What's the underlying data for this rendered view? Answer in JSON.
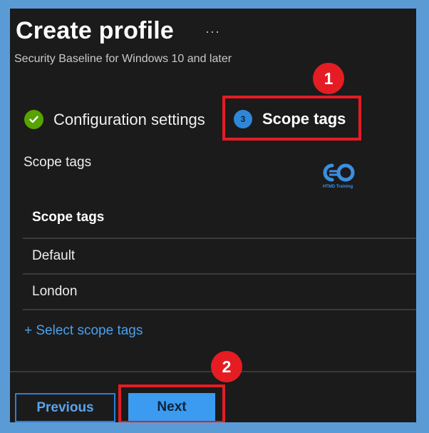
{
  "header": {
    "title": "Create profile",
    "more_label": "···",
    "subtitle": "Security Baseline for Windows 10 and later"
  },
  "steps": [
    {
      "label": "Configuration settings",
      "status": "complete",
      "icon": "check-circle-icon"
    },
    {
      "label": "Scope tags",
      "number": "3",
      "status": "current",
      "icon": "step-number-icon"
    }
  ],
  "annotations": {
    "marker_1": "1",
    "marker_2": "2",
    "color": "#e51c23"
  },
  "section": {
    "label": "Scope tags"
  },
  "watermark": {
    "text": "HTMD Training"
  },
  "table": {
    "header": "Scope tags",
    "rows": [
      "Default",
      "London"
    ]
  },
  "links": {
    "select_scope_tags": "+ Select scope tags"
  },
  "footer": {
    "previous_label": "Previous",
    "next_label": "Next"
  },
  "colors": {
    "accent": "#3a9bf0",
    "success": "#57a300",
    "background": "#1b1b1b",
    "frame": "#5b9bd5"
  }
}
